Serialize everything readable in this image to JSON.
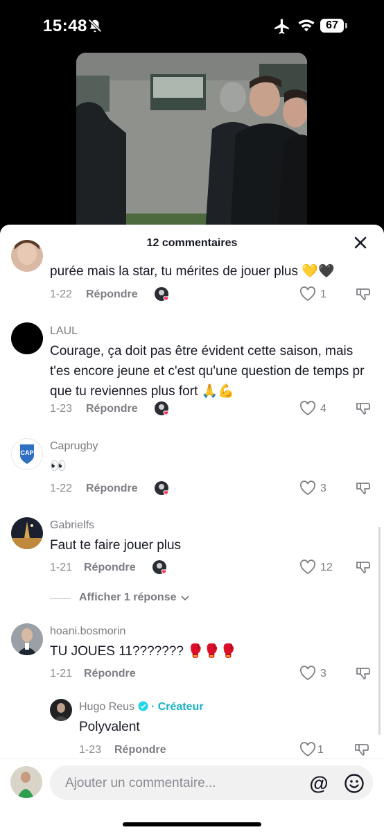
{
  "status_bar": {
    "time": "15:48",
    "battery": "67"
  },
  "sheet": {
    "title": "12 commentaires"
  },
  "comments": [
    {
      "text": "purée mais la star, tu mérites de jouer plus 💛🖤",
      "date": "1-22",
      "reply_label": "Répondre",
      "likes": "1"
    },
    {
      "username": "LAUL",
      "text": "Courage, ça doit pas être évident cette saison, mais t'es encore jeune et c'est qu'une question de temps pr que tu reviennes plus fort 🙏💪",
      "date": "1-23",
      "reply_label": "Répondre",
      "likes": "4"
    },
    {
      "username": "Caprugby",
      "text": "👀",
      "date": "1-22",
      "reply_label": "Répondre",
      "likes": "3"
    },
    {
      "username": "Gabrielfs",
      "text": "Faut te faire jouer plus",
      "date": "1-21",
      "reply_label": "Répondre",
      "likes": "12",
      "view_replies": "Afficher 1 réponse"
    },
    {
      "username": "hoani.bosmorin",
      "text": "TU JOUES 11??????? 🥊🥊🥊",
      "date": "1-21",
      "reply_label": "Répondre",
      "likes": "3"
    }
  ],
  "reply": {
    "username": "Hugo Reus",
    "creator_label": "· Créateur",
    "text": "Polyvalent",
    "date": "1-23",
    "reply_label": "Répondre",
    "likes": "1"
  },
  "input": {
    "placeholder": "Ajouter un commentaire..."
  },
  "colors": {
    "accent": "#16b2c7",
    "heart": "#fe2c55",
    "text": "#161823",
    "muted": "#8a8b91"
  },
  "icons": [
    "bell-slash-icon",
    "airplane-icon",
    "wifi-icon",
    "battery-icon",
    "close-icon",
    "heart-icon",
    "dislike-icon",
    "verified-icon",
    "chevron-down-icon",
    "at-icon",
    "emoji-icon"
  ]
}
